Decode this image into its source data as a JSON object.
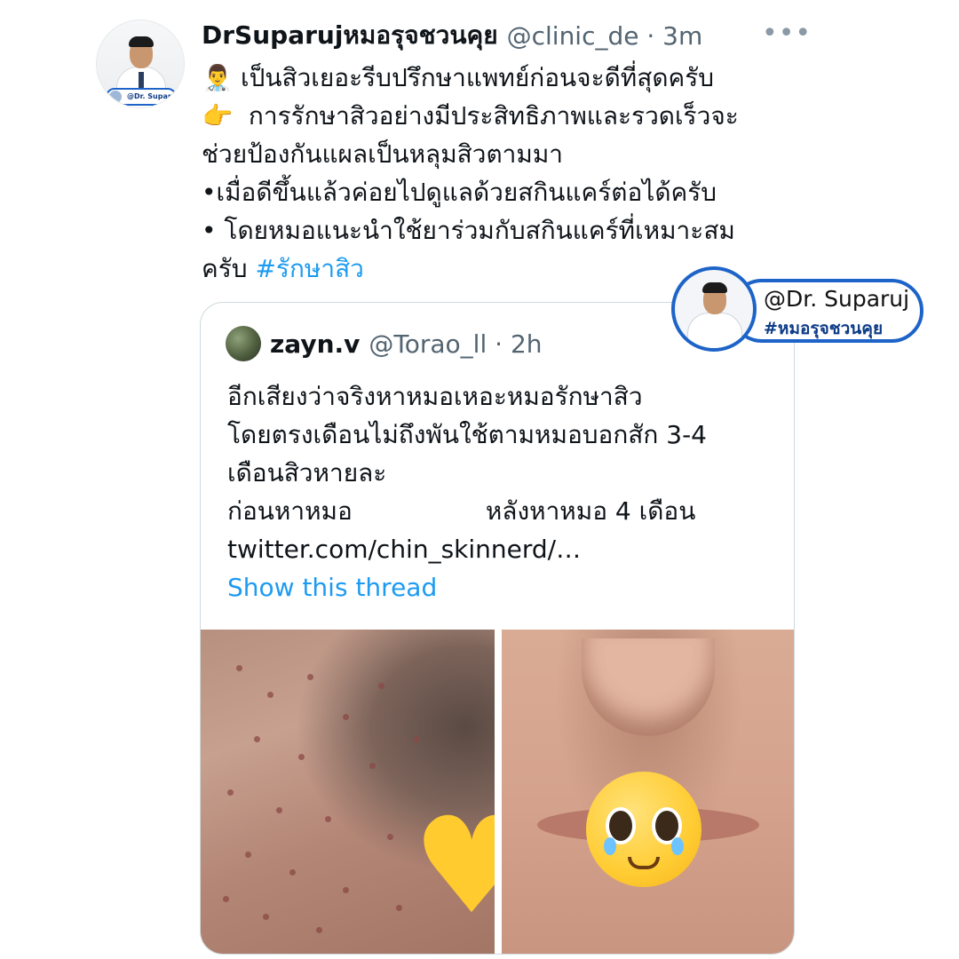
{
  "tweet": {
    "display_name": "DrSuparujหมอรุจชวนคุย",
    "handle": "@clinic_de · 3m",
    "more_icon": "more-horizontal-icon",
    "avatar_tag": "@Dr. Suparuj",
    "lines": [
      {
        "emoji": "👨‍⚕️",
        "text": "เป็นสิวเยอะรีบปรึกษาแพทย์ก่อนจะดีที่สุดครับ"
      },
      {
        "emoji": "👉",
        "text": " การรักษาสิวอย่างมีประสิทธิภาพและรวดเร็วจะ"
      },
      {
        "text": "ช่วยป้องกันแผลเป็นหลุมสิวตามมา"
      },
      {
        "text": "•เมื่อดีขึ้นแล้วค่อยไปดูแลด้วยสกินแคร์ต่อได้ครับ"
      },
      {
        "text": "• โดยหมอแนะนำใช้ยาร่วมกับสกินแคร์ที่เหมาะสม"
      }
    ],
    "last_line_text": "ครับ ",
    "hashtag": "#รักษาสิว"
  },
  "badge": {
    "line1": "@Dr. Suparuj",
    "line2": "#หมอรุจชวนคุย"
  },
  "quote": {
    "display_name": "zayn.v",
    "handle": "@Torao_ll · 2h",
    "lines": [
      "อีกเสียงว่าจริงหาหมอเหอะหมอรักษาสิว",
      "โดยตรงเดือนไม่ถึงพันใช้ตามหมอบอกสัก 3-4",
      "เดือนสิวหายละ"
    ],
    "before_label": "ก่อนหาหมอ",
    "after_label": "หลังหาหมอ 4 เดือน",
    "link": "twitter.com/chin_skinnerd/…",
    "show_thread": "Show this thread"
  },
  "colors": {
    "text": "#0f1419",
    "secondary": "#536471",
    "link": "#1d9bf0",
    "badge_blue": "#1d63c8"
  }
}
